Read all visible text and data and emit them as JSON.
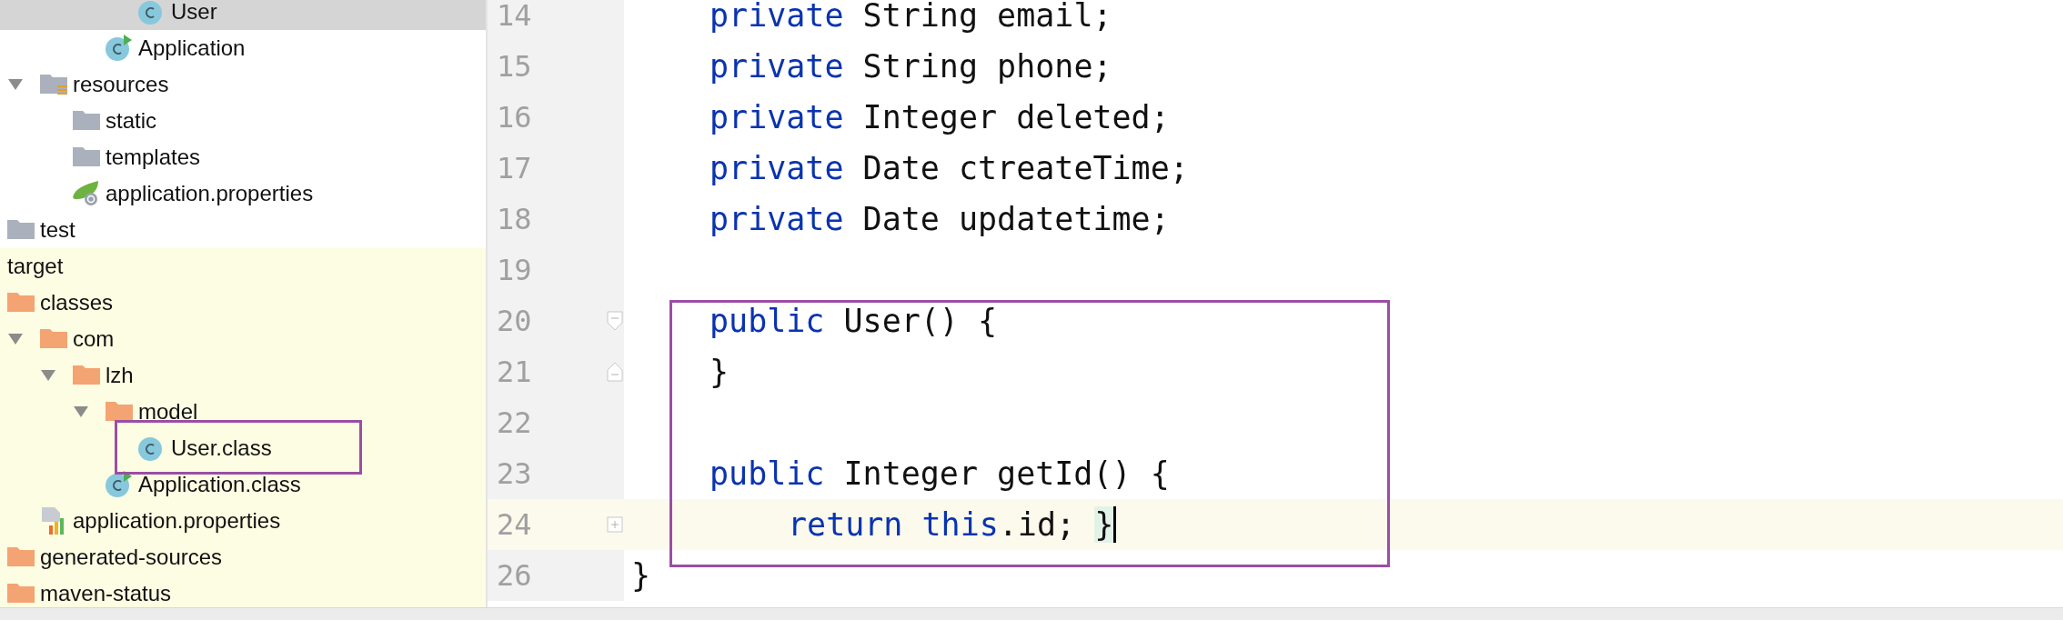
{
  "tree": [
    {
      "children": [
        {
          "children": [
            {
              "children": [
                {
                  "children": [
                    {
                      "label": "User",
                      "kind": "class",
                      "selected": true,
                      "excluded": false
                    }
                  ]
                },
                {
                  "label": "Application",
                  "kind": "main-class",
                  "selected": false,
                  "excluded": false
                }
              ]
            }
          ]
        },
        {
          "label": "resources",
          "kind": "resources-folder",
          "expanded": true,
          "selected": false,
          "excluded": false,
          "children": [
            {
              "label": "static",
              "kind": "folder",
              "selected": false,
              "excluded": false
            },
            {
              "label": "templates",
              "kind": "folder",
              "selected": false,
              "excluded": false
            },
            {
              "label": "application.properties",
              "kind": "spring-properties",
              "selected": false,
              "excluded": false
            }
          ]
        }
      ]
    },
    {
      "label": "test",
      "kind": "folder",
      "selected": false,
      "excluded": false
    },
    {
      "label": "target",
      "kind": "plain",
      "selected": false,
      "excluded": true
    },
    {
      "label": "classes",
      "kind": "output-folder",
      "selected": false,
      "excluded": true,
      "children": [
        {
          "label": "com",
          "kind": "output-folder",
          "expanded": true,
          "selected": false,
          "excluded": true,
          "children": [
            {
              "label": "lzh",
              "kind": "output-folder",
              "expanded": true,
              "selected": false,
              "excluded": true,
              "children": [
                {
                  "label": "model",
                  "kind": "output-folder",
                  "expanded": true,
                  "selected": false,
                  "excluded": true,
                  "children": [
                    {
                      "label": "User.class",
                      "kind": "class",
                      "selected": false,
                      "excluded": true
                    }
                  ]
                },
                {
                  "label": "Application.class",
                  "kind": "main-class",
                  "selected": false,
                  "excluded": true
                }
              ]
            }
          ]
        },
        {
          "label": "application.properties",
          "kind": "properties",
          "selected": false,
          "excluded": true
        }
      ]
    },
    {
      "label": "generated-sources",
      "kind": "output-folder",
      "selected": false,
      "excluded": true
    },
    {
      "label": "maven-status",
      "kind": "output-folder",
      "selected": false,
      "excluded": true
    }
  ],
  "editor": {
    "lines": [
      {
        "number": "14",
        "kind": "member",
        "current": false,
        "tokens": [
          {
            "text": "private",
            "kind": "keyword"
          },
          {
            "text": " String email;"
          }
        ]
      },
      {
        "number": "15",
        "kind": "member",
        "current": false,
        "tokens": [
          {
            "text": "private",
            "kind": "keyword"
          },
          {
            "text": " String phone;"
          }
        ]
      },
      {
        "number": "16",
        "kind": "member",
        "current": false,
        "tokens": [
          {
            "text": "private",
            "kind": "keyword"
          },
          {
            "text": " Integer deleted;"
          }
        ]
      },
      {
        "number": "17",
        "kind": "member",
        "current": false,
        "tokens": [
          {
            "text": "private",
            "kind": "keyword"
          },
          {
            "text": " Date ctreateTime;"
          }
        ]
      },
      {
        "number": "18",
        "kind": "member",
        "current": false,
        "tokens": [
          {
            "text": "private",
            "kind": "keyword"
          },
          {
            "text": " Date updatetime;"
          }
        ]
      },
      {
        "number": "19",
        "kind": "blank",
        "current": false
      },
      {
        "number": "20",
        "kind": "member",
        "current": false,
        "fold_marker": {
          "kind": "start"
        },
        "tokens": [
          {
            "text": "public",
            "kind": "keyword"
          },
          {
            "text": " User() {"
          }
        ]
      },
      {
        "number": "21",
        "kind": "member",
        "current": false,
        "fold_marker": {
          "kind": "end"
        },
        "tokens": [
          {
            "text": "}"
          }
        ]
      },
      {
        "number": "22",
        "kind": "blank",
        "current": false
      },
      {
        "number": "23",
        "kind": "member",
        "current": false,
        "tokens": [
          {
            "text": "public",
            "kind": "keyword"
          },
          {
            "text": " Integer getId() {"
          }
        ]
      },
      {
        "number": "24",
        "kind": "statement",
        "current": true,
        "fold_marker": {
          "kind": "collapsed"
        },
        "tokens": [
          {
            "text": "return",
            "kind": "keyword"
          },
          {
            "text": " this",
            "kind": "keyword"
          },
          {
            "text": ".id; "
          },
          {
            "text": "}",
            "kind": "matched-brace"
          }
        ]
      },
      {
        "number": "26",
        "kind": "class-end",
        "current": false,
        "tokens": [
          {
            "text": "}"
          }
        ]
      }
    ]
  }
}
